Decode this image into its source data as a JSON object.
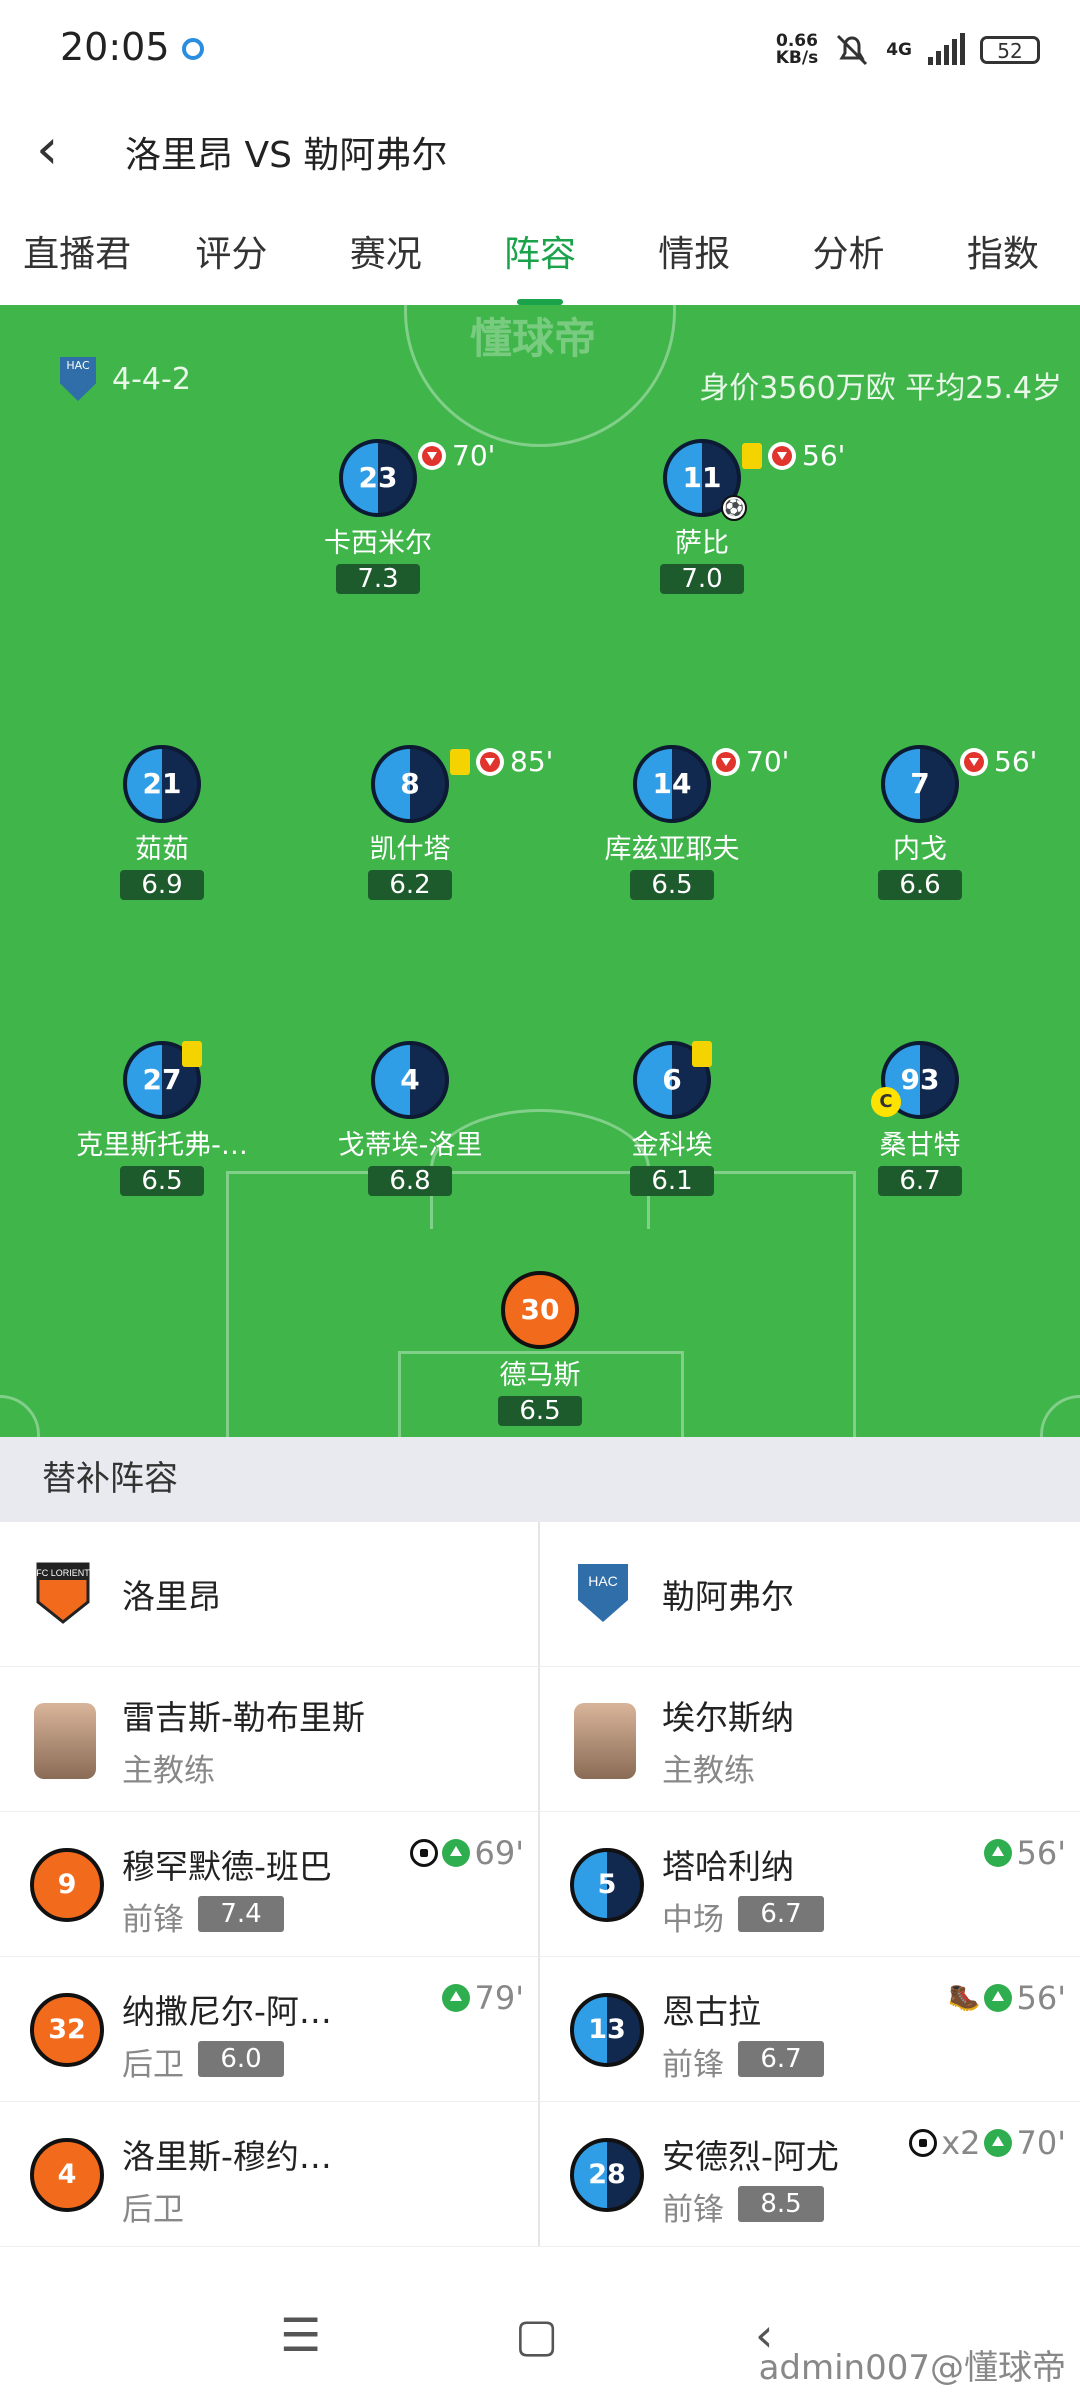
{
  "status": {
    "time": "20:05",
    "net_speed": "0.66",
    "net_unit": "KB/s",
    "signal": "4G",
    "battery": "52"
  },
  "header": {
    "title": "洛里昂 VS 勒阿弗尔"
  },
  "tabs": [
    "直播君",
    "评分",
    "赛况",
    "阵容",
    "情报",
    "分析",
    "指数"
  ],
  "active_tab": 3,
  "pitch": {
    "watermark": "懂球帝",
    "formation": "4-4-2",
    "team_value": "身价3560万欧 平均25.4岁",
    "players": [
      {
        "number": "23",
        "name": "卡西米尔",
        "rating": "7.3",
        "event_minute": "70'"
      },
      {
        "number": "11",
        "name": "萨比",
        "rating": "7.0",
        "event_minute": "56'"
      },
      {
        "number": "21",
        "name": "茹茹",
        "rating": "6.9",
        "event_minute": ""
      },
      {
        "number": "8",
        "name": "凯什塔",
        "rating": "6.2",
        "event_minute": "85'"
      },
      {
        "number": "14",
        "name": "库兹亚耶夫",
        "rating": "6.5",
        "event_minute": "70'"
      },
      {
        "number": "7",
        "name": "内戈",
        "rating": "6.6",
        "event_minute": "56'"
      },
      {
        "number": "27",
        "name": "克里斯托弗-…",
        "rating": "6.5",
        "event_minute": ""
      },
      {
        "number": "4",
        "name": "戈蒂埃-洛里",
        "rating": "6.8",
        "event_minute": ""
      },
      {
        "number": "6",
        "name": "金科埃",
        "rating": "6.1",
        "event_minute": ""
      },
      {
        "number": "93",
        "name": "桑甘特",
        "rating": "6.7",
        "event_minute": "",
        "captain": "C"
      },
      {
        "number": "30",
        "name": "德马斯",
        "rating": "6.5",
        "event_minute": ""
      }
    ]
  },
  "subs": {
    "section_title": "替补阵容",
    "home_team": "洛里昂",
    "away_team": "勒阿弗尔",
    "home_team_logo_text": "FC LORIENT",
    "away_team_logo_text": "HAC",
    "home_coach": {
      "name": "雷吉斯-勒布里斯",
      "role": "主教练"
    },
    "away_coach": {
      "name": "埃尔斯纳",
      "role": "主教练"
    },
    "home_players": [
      {
        "number": "9",
        "name": "穆罕默德-班巴",
        "position": "前锋",
        "rating": "7.4",
        "minute": "69'"
      },
      {
        "number": "32",
        "name": "纳撒尼尔-阿…",
        "position": "后卫",
        "rating": "6.0",
        "minute": "79'"
      },
      {
        "number": "4",
        "name": "洛里斯-穆约…",
        "position": "后卫",
        "rating": "",
        "minute": ""
      }
    ],
    "away_players": [
      {
        "number": "5",
        "name": "塔哈利纳",
        "position": "中场",
        "rating": "6.7",
        "minute": "56'"
      },
      {
        "number": "13",
        "name": "恩古拉",
        "position": "前锋",
        "rating": "6.7",
        "minute": "56'"
      },
      {
        "number": "28",
        "name": "安德烈-阿尤",
        "position": "前锋",
        "rating": "8.5",
        "minute": "70'",
        "goals": "x2"
      }
    ]
  },
  "footer": {
    "watermark": "admin007@懂球帝"
  }
}
